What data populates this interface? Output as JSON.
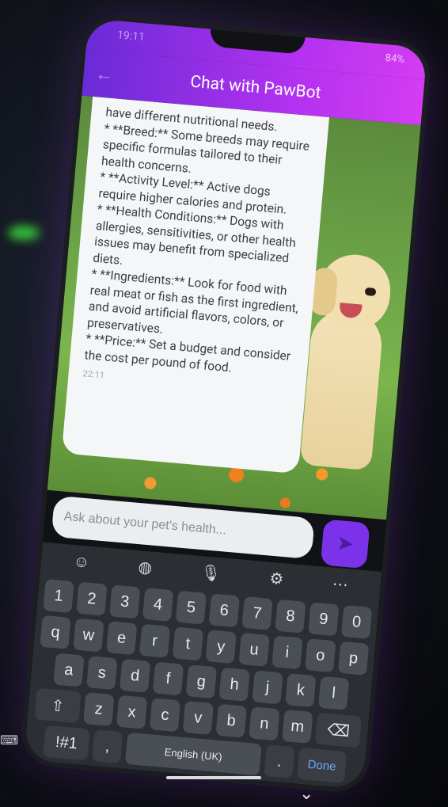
{
  "status_bar": {
    "time": "19:11",
    "battery": "84%"
  },
  "app_bar": {
    "title": "Chat with PawBot"
  },
  "message": {
    "lines": [
      "have different nutritional needs.",
      "* **Breed:** Some breeds may require specific formulas tailored to their health concerns.",
      "* **Activity Level:** Active dogs require higher calories and protein.",
      "* **Health Conditions:** Dogs with allergies, sensitivities, or other health issues may benefit from specialized diets.",
      "* **Ingredients:** Look for food with real meat or fish as the first ingredient, and avoid artificial flavors, colors, or preservatives.",
      "* **Price:** Set a budget and consider the cost per pound of food."
    ],
    "timestamp": "22:11"
  },
  "composer": {
    "placeholder": "Ask about your pet's health..."
  },
  "keyboard": {
    "toolbar": [
      "emoji-icon",
      "sticker-icon",
      "mic-icon",
      "settings-icon",
      "more-icon"
    ],
    "row_numbers": [
      "1",
      "2",
      "3",
      "4",
      "5",
      "6",
      "7",
      "8",
      "9",
      "0"
    ],
    "row1": [
      "q",
      "w",
      "e",
      "r",
      "t",
      "y",
      "u",
      "i",
      "o",
      "p"
    ],
    "row2": [
      "a",
      "s",
      "d",
      "f",
      "g",
      "h",
      "j",
      "k",
      "l"
    ],
    "row3": [
      "z",
      "x",
      "c",
      "v",
      "b",
      "n",
      "m"
    ],
    "symbols_label": "!#1",
    "comma": ",",
    "space_label": "English (UK)",
    "period": ".",
    "done_label": "Done"
  }
}
